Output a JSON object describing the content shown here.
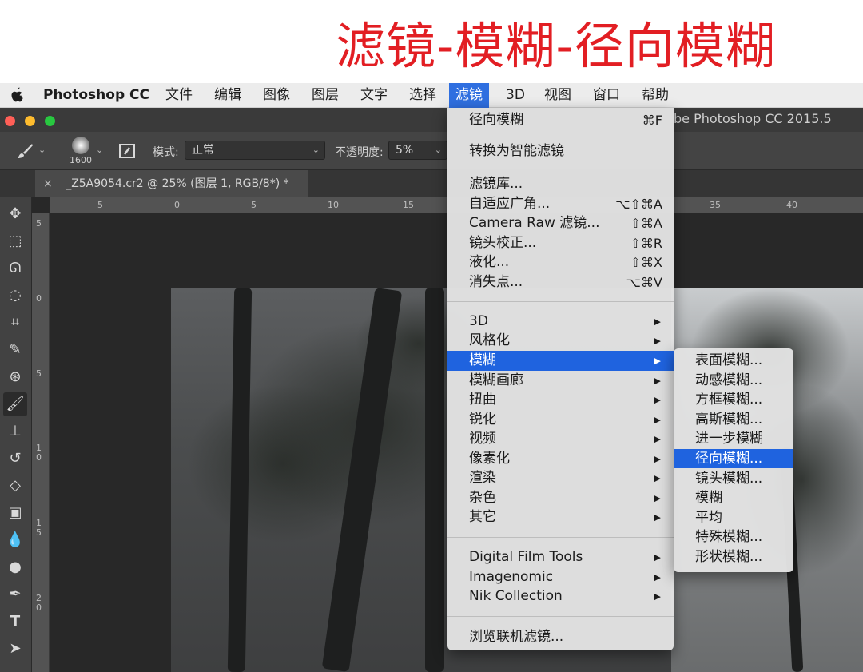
{
  "banner": {
    "title": "滤镜-模糊-径向模糊"
  },
  "menubar": {
    "app_name": "Photoshop CC",
    "items": [
      "文件",
      "编辑",
      "图像",
      "图层",
      "文字",
      "选择",
      "滤镜",
      "3D",
      "视图",
      "窗口",
      "帮助"
    ],
    "active": "滤镜"
  },
  "window": {
    "title_fragment": "be Photoshop CC 2015.5",
    "traffic_light_colors": {
      "close": "#ff5f57",
      "minimize": "#febc2e",
      "zoom": "#28c840"
    }
  },
  "options": {
    "brush_size": "1600",
    "mode_label": "模式:",
    "mode_value": "正常",
    "opacity_label": "不透明度:",
    "opacity_value": "5%"
  },
  "document": {
    "tab_label": "_Z5A9054.cr2 @ 25% (图层 1, RGB/8*) *",
    "close_glyph": "×"
  },
  "rulers": {
    "horizontal": [
      "5",
      "0",
      "5",
      "10",
      "15",
      "35",
      "40"
    ],
    "vertical": [
      "5",
      "0",
      "5",
      "1\n0",
      "1\n5",
      "2\n0"
    ]
  },
  "filter_menu": {
    "items": [
      {
        "label": "径向模糊",
        "shortcut": "⌘F"
      },
      {
        "label": "转换为智能滤镜"
      },
      {
        "label": "滤镜库..."
      },
      {
        "label": "自适应广角...",
        "shortcut": "⌥⇧⌘A"
      },
      {
        "label": "Camera Raw 滤镜...",
        "shortcut": "⇧⌘A"
      },
      {
        "label": "镜头校正...",
        "shortcut": "⇧⌘R"
      },
      {
        "label": "液化...",
        "shortcut": "⇧⌘X"
      },
      {
        "label": "消失点...",
        "shortcut": "⌥⌘V"
      },
      {
        "label": "3D",
        "submenu": true
      },
      {
        "label": "风格化",
        "submenu": true
      },
      {
        "label": "模糊",
        "submenu": true,
        "highlighted": true
      },
      {
        "label": "模糊画廊",
        "submenu": true
      },
      {
        "label": "扭曲",
        "submenu": true
      },
      {
        "label": "锐化",
        "submenu": true
      },
      {
        "label": "视频",
        "submenu": true
      },
      {
        "label": "像素化",
        "submenu": true
      },
      {
        "label": "渲染",
        "submenu": true
      },
      {
        "label": "杂色",
        "submenu": true
      },
      {
        "label": "其它",
        "submenu": true
      },
      {
        "label": "Digital Film Tools",
        "submenu": true
      },
      {
        "label": "Imagenomic",
        "submenu": true
      },
      {
        "label": "Nik Collection",
        "submenu": true
      },
      {
        "label": "浏览联机滤镜..."
      }
    ],
    "arrow_glyph": "▶"
  },
  "blur_submenu": {
    "items": [
      "表面模糊...",
      "动感模糊...",
      "方框模糊...",
      "高斯模糊...",
      "进一步模糊",
      "径向模糊...",
      "镜头模糊...",
      "模糊",
      "平均",
      "特殊模糊...",
      "形状模糊..."
    ],
    "highlighted": "径向模糊..."
  },
  "colors": {
    "accent": "#1f63df",
    "banner_red": "#e21e23"
  },
  "tools": [
    "move-tool",
    "marquee-tool",
    "lasso-tool",
    "quick-select-tool",
    "crop-tool",
    "eyedropper-tool",
    "healing-tool",
    "brush-tool",
    "stamp-tool",
    "history-brush-tool",
    "eraser-tool",
    "gradient-tool",
    "blur-tool",
    "dodge-tool",
    "pen-tool",
    "type-tool",
    "path-select-tool"
  ]
}
